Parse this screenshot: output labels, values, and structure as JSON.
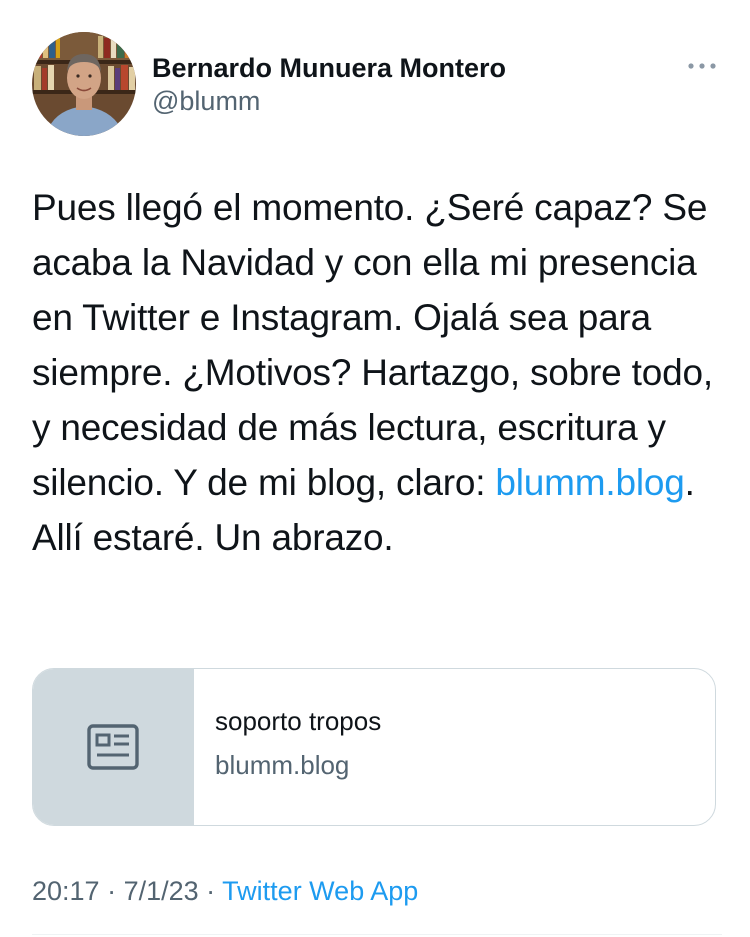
{
  "author": {
    "display_name": "Bernardo Munuera Montero",
    "handle": "@blumm"
  },
  "tweet": {
    "text_before_link": "Pues llegó el momento. ¿Seré capaz? Se acaba la Navidad y con ella mi presencia en Twitter e Instagram. Ojalá sea para siempre. ¿Motivos? Hartazgo, sobre todo, y necesidad de más lectura, escritura y silencio. Y de mi blog, claro: ",
    "link_text": "blumm.blog",
    "text_after_link": ". Allí estaré. Un abrazo."
  },
  "card": {
    "title": "soporto tropos",
    "domain": "blumm.blog",
    "thumbnail_icon": "article-icon"
  },
  "meta": {
    "time": "20:17",
    "separator1": " · ",
    "date": "7/1/23",
    "separator2": " · ",
    "source": "Twitter Web App"
  },
  "icons": {
    "more": "more-horizontal-icon"
  },
  "colors": {
    "link": "#1d9bf0",
    "secondary_text": "#536471",
    "primary_text": "#0f1419",
    "card_border": "#cfd9de",
    "card_thumb_bg": "#cfd9de"
  }
}
